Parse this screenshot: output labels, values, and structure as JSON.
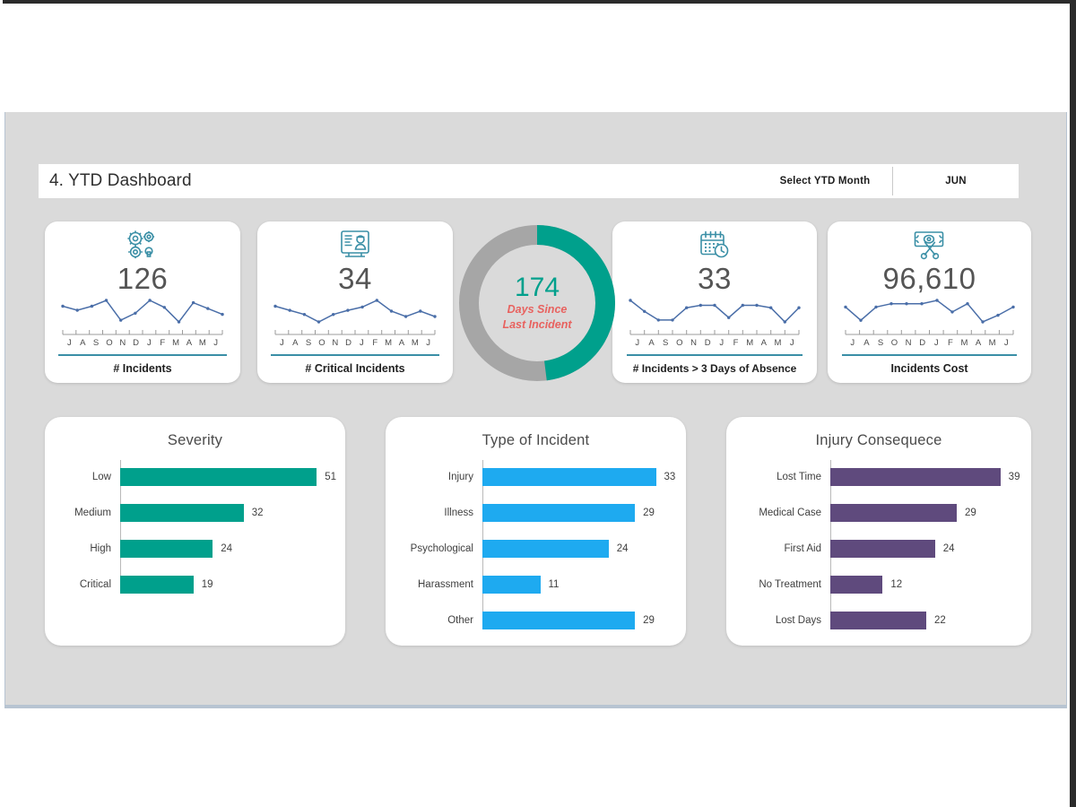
{
  "header": {
    "title": "4. YTD Dashboard",
    "select_label": "Select YTD Month",
    "selected_month": "JUN",
    "bar_color": "#2b4a6f"
  },
  "colors": {
    "teal": "#00a08c",
    "blue": "#1eaaf0",
    "purple": "#5f4a7d",
    "gray": "#a6a6a6",
    "red": "#e8625f",
    "icon_teal": "#3a8fa6"
  },
  "kpis": [
    {
      "icon": "gears-icon",
      "value": "126",
      "label": "# Incidents",
      "months": [
        "J",
        "A",
        "S",
        "O",
        "N",
        "D",
        "J",
        "F",
        "M",
        "A",
        "M",
        "J"
      ],
      "spark": [
        62,
        55,
        62,
        72,
        38,
        50,
        72,
        60,
        35,
        68,
        58,
        48
      ]
    },
    {
      "icon": "incident-report-icon",
      "value": "34",
      "label": "# Critical Incidents",
      "months": [
        "J",
        "A",
        "S",
        "O",
        "N",
        "D",
        "J",
        "F",
        "M",
        "A",
        "M",
        "J"
      ],
      "spark": [
        70,
        60,
        50,
        32,
        50,
        60,
        68,
        84,
        58,
        45,
        58,
        45
      ]
    },
    {
      "icon": "calendar-clock-icon",
      "value": "33",
      "label": "# Incidents > 3 Days of Absence",
      "months": [
        "J",
        "A",
        "S",
        "O",
        "N",
        "D",
        "J",
        "F",
        "M",
        "A",
        "M",
        "J"
      ],
      "spark": [
        70,
        52,
        38,
        38,
        58,
        62,
        62,
        42,
        62,
        62,
        58,
        35,
        58
      ]
    },
    {
      "icon": "money-scissors-icon",
      "value": "96,610",
      "label": "Incidents Cost",
      "months": [
        "J",
        "A",
        "S",
        "O",
        "N",
        "D",
        "J",
        "F",
        "M",
        "A",
        "M",
        "J"
      ],
      "spark": [
        58,
        42,
        58,
        62,
        62,
        62,
        66,
        52,
        62,
        40,
        48,
        58
      ]
    }
  ],
  "donut": {
    "value": "174",
    "subtitle_line1": "Days Since",
    "subtitle_line2": "Last Incident",
    "percent": 48,
    "filled_color": "#00a08c",
    "track_color": "#a6a6a6"
  },
  "chart_data": [
    {
      "type": "bar",
      "orientation": "horizontal",
      "title": "Severity",
      "categories": [
        "Low",
        "Medium",
        "High",
        "Critical"
      ],
      "values": [
        51,
        32,
        24,
        19
      ],
      "color": "#00a08c",
      "xlabel": "",
      "ylabel": "",
      "xlim": [
        0,
        56
      ],
      "grid": false,
      "legend": "none",
      "data_labels": true
    },
    {
      "type": "bar",
      "orientation": "horizontal",
      "title": "Type of Incident",
      "categories": [
        "Injury",
        "Illness",
        "Psychological",
        "Harassment",
        "Other"
      ],
      "values": [
        33,
        29,
        24,
        11,
        29
      ],
      "color": "#1eaaf0",
      "xlabel": "",
      "ylabel": "",
      "xlim": [
        0,
        37
      ],
      "grid": false,
      "legend": "none",
      "data_labels": true
    },
    {
      "type": "bar",
      "orientation": "horizontal",
      "title": "Injury Consequece",
      "categories": [
        "Lost Time",
        "Medical Case",
        "First Aid",
        "No Treatment",
        "Lost Days"
      ],
      "values": [
        39,
        29,
        24,
        12,
        22
      ],
      "color": "#5f4a7d",
      "xlabel": "",
      "ylabel": "",
      "xlim": [
        0,
        44
      ],
      "grid": false,
      "legend": "none",
      "data_labels": true
    }
  ]
}
